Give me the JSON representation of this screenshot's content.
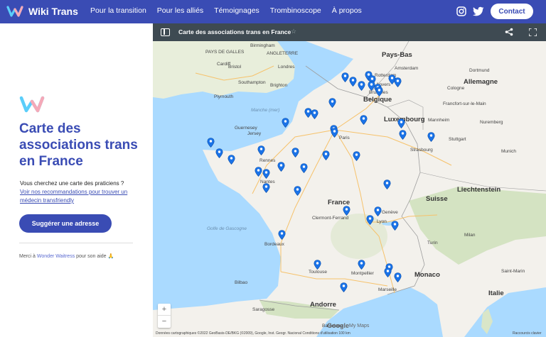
{
  "nav": {
    "brand": "Wiki Trans",
    "links": [
      "Pour la transition",
      "Pour les alliés",
      "Témoignages",
      "Trombinoscope",
      "À propos"
    ],
    "contact": "Contact"
  },
  "panel": {
    "title": "Carte des associations trans en France",
    "subtitle": "Vous cherchez une carte des praticiens ?",
    "link": "Voir nos recommandations pour trouver un médecin transfriendly",
    "button": "Suggérer une adresse",
    "thanks_prefix": "Merci à ",
    "thanks_name": "Wonder Waitress",
    "thanks_suffix": " pour son aide 🙏"
  },
  "map": {
    "header_title": "Carte des associations trans en France",
    "countries": [
      "Pays-Bas",
      "Belgique",
      "Luxembourg",
      "Allemagne",
      "France",
      "Suisse",
      "Liechtenstein",
      "Monaco",
      "Italie",
      "Andorre"
    ],
    "cities": [
      "PAYS DE GALLES",
      "ANGLETERRE",
      "Birmingham",
      "Cardiff",
      "Bristol",
      "Londres",
      "Southampton",
      "Brighton",
      "Plymouth",
      "Guernesey",
      "Jersey",
      "Amsterdam",
      "Rotterdam",
      "Anvers",
      "Bruxelles",
      "Dortmund",
      "Cologne",
      "Francfort-sur-le-Main",
      "Mannheim",
      "Nuremberg",
      "Stuttgart",
      "Strasbourg",
      "Munich",
      "Paris",
      "Rennes",
      "Nantes",
      "Genève",
      "Clermont-Ferrand",
      "Lyon",
      "Milan",
      "Turin",
      "Bordeaux",
      "Bilbao",
      "Toulouse",
      "Montpellier",
      "Marseille",
      "Saint-Marin",
      "Saragosse",
      "Barcelone"
    ],
    "seas": [
      "Manche (mer)",
      "Golfe de Gascogne"
    ],
    "zoom_in": "+",
    "zoom_out": "−",
    "google": "Google",
    "mymaps": "My Maps",
    "attribution": "Données cartographiques ©2022 GeoBasis-DE/BKG (©2009), Google, Inst. Geogr. Nacional  Conditions d'utilisation  100 km",
    "shortcuts": "Raccourcis clavier"
  },
  "colors": {
    "brand": "#3a4cb4",
    "map_header": "#3e4a52",
    "water": "#aadaff",
    "land": "#f3f1ec",
    "pin": "#1a73e8"
  }
}
